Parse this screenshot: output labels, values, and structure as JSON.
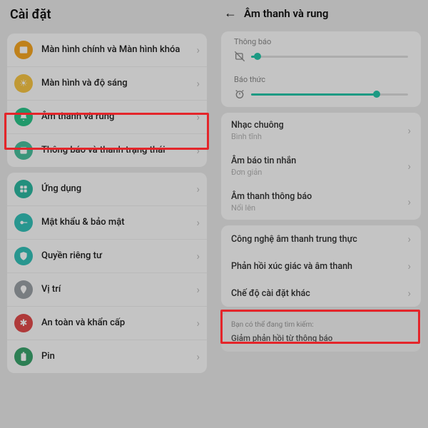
{
  "left": {
    "title": "Cài đặt",
    "groups": [
      [
        {
          "icon": "picture",
          "color": "ic-orange",
          "label": "Màn hình chính và Màn hình khóa"
        },
        {
          "icon": "sun",
          "color": "ic-yellow",
          "label": "Màn hình và độ sáng"
        },
        {
          "icon": "bell",
          "color": "ic-green",
          "label": "Âm thanh và rung"
        },
        {
          "icon": "status",
          "color": "ic-tealgr",
          "label": "Thông báo và thanh trạng thái"
        }
      ],
      [
        {
          "icon": "apps",
          "color": "ic-teal",
          "label": "Ứng dụng"
        },
        {
          "icon": "key",
          "color": "ic-cyan",
          "label": "Mật khẩu & bảo mật"
        },
        {
          "icon": "shield",
          "color": "ic-cyan",
          "label": "Quyền riêng tư"
        },
        {
          "icon": "pin",
          "color": "ic-gray",
          "label": "Vị trí"
        },
        {
          "icon": "sos",
          "color": "ic-red",
          "label": "An toàn và khẩn cấp"
        },
        {
          "icon": "battery",
          "color": "ic-dgreen",
          "label": "Pin"
        }
      ]
    ]
  },
  "right": {
    "title": "Âm thanh và rung",
    "sliders": {
      "notification": {
        "label": "Thông báo",
        "percent": 4
      },
      "alarm": {
        "label": "Báo thức",
        "percent": 80
      }
    },
    "sounds": [
      {
        "title": "Nhạc chuông",
        "sub": "Bình tĩnh"
      },
      {
        "title": "Âm báo tin nhắn",
        "sub": "Đơn giản"
      },
      {
        "title": "Âm thanh thông báo",
        "sub": "Nổi lên"
      }
    ],
    "options": [
      "Công nghệ âm thanh trung thực",
      "Phản hồi xúc giác và âm thanh",
      "Chế độ cài đặt khác"
    ],
    "hint": {
      "small": "Bạn có thể đang tìm kiếm:",
      "main": "Giảm phản hồi từ thông báo"
    }
  }
}
